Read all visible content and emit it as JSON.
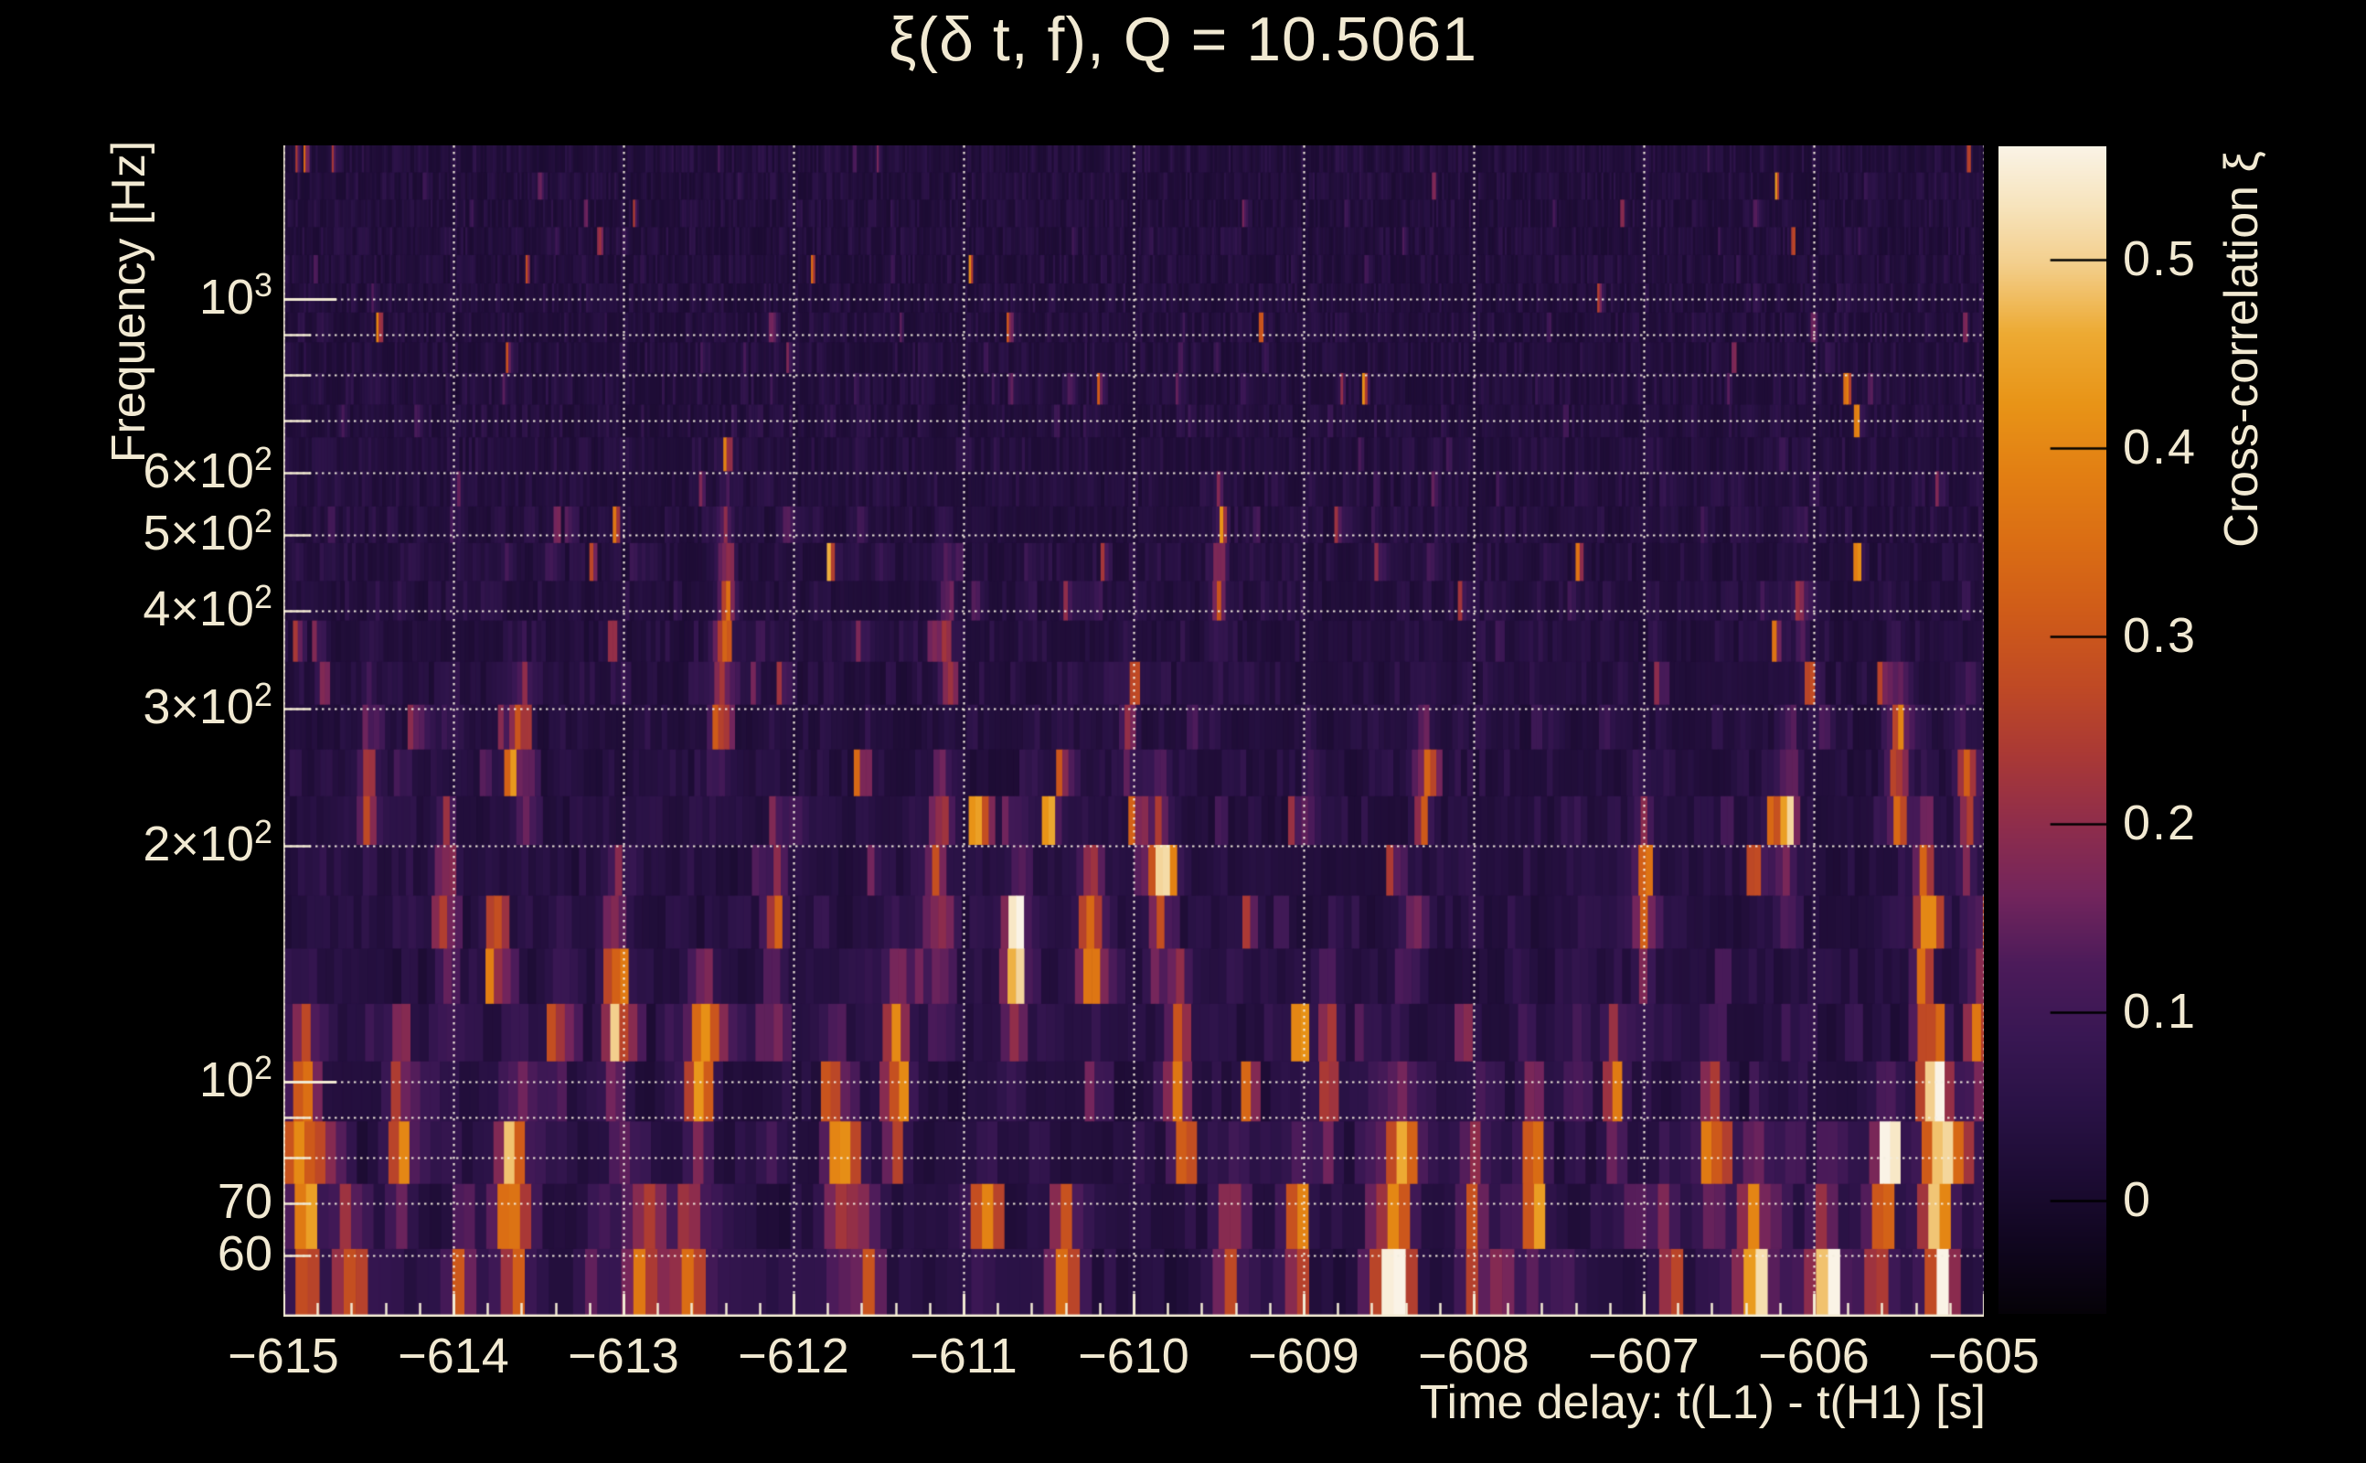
{
  "title": {
    "text": "ξ(δ t, f), Q = 10.5061"
  },
  "colors": {
    "background": "#000000",
    "text": "#f1e9d2",
    "grid": "#f4eede",
    "tick": "#f1e9d2",
    "frame": "#f1e9d2",
    "colorbar_tick": "#000000"
  },
  "chart_data": {
    "type": "heatmap",
    "title": "ξ(δ t, f), Q = 10.5061",
    "q_value": 10.5061,
    "xlabel": "Time delay: t(L1) - t(H1) [s]",
    "ylabel": "Frequency [Hz]",
    "zlabel": "Cross-correlation ξ",
    "x_range": [
      -615,
      -605
    ],
    "x_minor_step": 0.2,
    "x_ticks": [
      {
        "label": "−615",
        "value": -615
      },
      {
        "label": "−614",
        "value": -614
      },
      {
        "label": "−613",
        "value": -613
      },
      {
        "label": "−612",
        "value": -612
      },
      {
        "label": "−611",
        "value": -611
      },
      {
        "label": "−610",
        "value": -610
      },
      {
        "label": "−609",
        "value": -609
      },
      {
        "label": "−608",
        "value": -608
      },
      {
        "label": "−607",
        "value": -607
      },
      {
        "label": "−606",
        "value": -606
      },
      {
        "label": "−605",
        "value": -605
      }
    ],
    "y_scale": "log",
    "y_range_hz": [
      50.1,
      1572
    ],
    "y_ticks": [
      {
        "base": "10",
        "exp": "3",
        "value": 1000
      },
      {
        "base": "6×10",
        "exp": "2",
        "value": 600
      },
      {
        "base": "5×10",
        "exp": "2",
        "value": 500
      },
      {
        "base": "4×10",
        "exp": "2",
        "value": 400
      },
      {
        "base": "3×10",
        "exp": "2",
        "value": 300
      },
      {
        "base": "2×10",
        "exp": "2",
        "value": 200
      },
      {
        "base": "10",
        "exp": "2",
        "value": 100
      },
      {
        "base": "70",
        "exp": "",
        "value": 70
      },
      {
        "base": "60",
        "exp": "",
        "value": 60
      }
    ],
    "y_major_tick_hz": [
      100,
      1000
    ],
    "grid_hz": [
      60,
      70,
      80,
      90,
      100,
      200,
      300,
      400,
      500,
      600,
      700,
      800,
      900,
      1000
    ],
    "grid_style": "dotted",
    "colorbar": {
      "min": -0.06,
      "max": 0.56,
      "ticks": [
        {
          "label": "0.5",
          "value": 0.5
        },
        {
          "label": "0.4",
          "value": 0.4
        },
        {
          "label": "0.3",
          "value": 0.3
        },
        {
          "label": "0.2",
          "value": 0.2
        },
        {
          "label": "0.1",
          "value": 0.1
        },
        {
          "label": "0",
          "value": 0.0
        }
      ],
      "stops": [
        {
          "t": 0.0,
          "color": "#050207"
        },
        {
          "t": 0.06,
          "color": "#10061f"
        },
        {
          "t": 0.12,
          "color": "#1d0c34"
        },
        {
          "t": 0.18,
          "color": "#2a1246"
        },
        {
          "t": 0.24,
          "color": "#391753"
        },
        {
          "t": 0.3,
          "color": "#4c1b5a"
        },
        {
          "t": 0.36,
          "color": "#73255c"
        },
        {
          "t": 0.42,
          "color": "#8f2d4b"
        },
        {
          "t": 0.48,
          "color": "#aa3935"
        },
        {
          "t": 0.54,
          "color": "#c04a24"
        },
        {
          "t": 0.6,
          "color": "#cf5b19"
        },
        {
          "t": 0.66,
          "color": "#da6d14"
        },
        {
          "t": 0.72,
          "color": "#e27f13"
        },
        {
          "t": 0.78,
          "color": "#e89417"
        },
        {
          "t": 0.84,
          "color": "#edaa33"
        },
        {
          "t": 0.9,
          "color": "#f3cf8d"
        },
        {
          "t": 0.95,
          "color": "#f7e4bd"
        },
        {
          "t": 1.0,
          "color": "#faf3e6"
        }
      ]
    },
    "noise": {
      "seed": 77,
      "rows": 28,
      "row_height_min": 30,
      "row_height_growth": 45,
      "col_width_min": 2.2,
      "col_width_growth": 11
    },
    "events_columns": [
      "t_delay_s",
      "f_lo_hz",
      "f_hi_hz",
      "xi_peak",
      "sigma_s"
    ],
    "events": [
      [
        -614.88,
        55,
        105,
        0.3,
        0.06
      ],
      [
        -614.62,
        50,
        58,
        0.33,
        0.05
      ],
      [
        -614.5,
        200,
        280,
        0.18,
        0.035
      ],
      [
        -614.32,
        70,
        100,
        0.25,
        0.05
      ],
      [
        -614.05,
        140,
        190,
        0.22,
        0.04
      ],
      [
        -613.95,
        52,
        62,
        0.28,
        0.05
      ],
      [
        -613.65,
        62,
        92,
        0.38,
        0.06
      ],
      [
        -613.6,
        240,
        300,
        0.2,
        0.035
      ],
      [
        -613.4,
        100,
        130,
        0.22,
        0.04
      ],
      [
        -613.05,
        100,
        160,
        0.3,
        0.05
      ],
      [
        -612.9,
        50,
        60,
        0.34,
        0.06
      ],
      [
        -612.62,
        50,
        60,
        0.3,
        0.05
      ],
      [
        -612.55,
        85,
        115,
        0.42,
        0.05
      ],
      [
        -612.45,
        260,
        320,
        0.22,
        0.03
      ],
      [
        -612.4,
        330,
        520,
        0.16,
        0.03
      ],
      [
        -612.1,
        140,
        170,
        0.25,
        0.04
      ],
      [
        -611.75,
        65,
        95,
        0.3,
        0.05
      ],
      [
        -611.55,
        50,
        58,
        0.28,
        0.05
      ],
      [
        -611.4,
        90,
        130,
        0.32,
        0.05
      ],
      [
        -611.16,
        160,
        200,
        0.3,
        0.04
      ],
      [
        -611.1,
        300,
        420,
        0.15,
        0.03
      ],
      [
        -610.9,
        60,
        75,
        0.3,
        0.05
      ],
      [
        -610.7,
        130,
        175,
        0.38,
        0.05
      ],
      [
        -610.4,
        50,
        60,
        0.35,
        0.06
      ],
      [
        -610.25,
        125,
        170,
        0.35,
        0.05
      ],
      [
        -610.03,
        270,
        310,
        0.2,
        0.03
      ],
      [
        -609.85,
        160,
        210,
        0.38,
        0.045
      ],
      [
        -609.73,
        95,
        115,
        0.35,
        0.05
      ],
      [
        -609.5,
        380,
        500,
        0.16,
        0.03
      ],
      [
        -609.45,
        55,
        65,
        0.3,
        0.05
      ],
      [
        -609.05,
        55,
        75,
        0.32,
        0.05
      ],
      [
        -608.85,
        90,
        120,
        0.25,
        0.04
      ],
      [
        -608.57,
        50,
        57,
        0.3,
        0.05
      ],
      [
        -608.45,
        50,
        63,
        0.57,
        0.05
      ],
      [
        -608.45,
        63,
        92,
        0.3,
        0.05
      ],
      [
        -608.3,
        200,
        260,
        0.2,
        0.035
      ],
      [
        -608.0,
        55,
        70,
        0.3,
        0.05
      ],
      [
        -607.8,
        48,
        55,
        0.3,
        0.05
      ],
      [
        -607.65,
        60,
        85,
        0.33,
        0.05
      ],
      [
        -607.4,
        100,
        110,
        0.25,
        0.04
      ],
      [
        -607.17,
        92,
        105,
        0.3,
        0.045
      ],
      [
        -607.0,
        150,
        200,
        0.22,
        0.04
      ],
      [
        -606.85,
        55,
        65,
        0.28,
        0.05
      ],
      [
        -606.6,
        70,
        95,
        0.36,
        0.05
      ],
      [
        -606.35,
        50,
        70,
        0.38,
        0.06
      ],
      [
        -606.16,
        190,
        240,
        0.3,
        0.04
      ],
      [
        -606.08,
        390,
        440,
        0.16,
        0.03
      ],
      [
        -605.95,
        50,
        65,
        0.42,
        0.06
      ],
      [
        -605.6,
        55,
        80,
        0.35,
        0.05
      ],
      [
        -605.5,
        200,
        300,
        0.22,
        0.04
      ],
      [
        -605.35,
        90,
        200,
        0.26,
        0.04
      ],
      [
        -605.26,
        83,
        97,
        0.5,
        0.045
      ],
      [
        -605.26,
        50,
        80,
        0.33,
        0.05
      ],
      [
        -605.1,
        210,
        270,
        0.25,
        0.04
      ],
      [
        -605.03,
        100,
        135,
        0.35,
        0.045
      ]
    ]
  }
}
